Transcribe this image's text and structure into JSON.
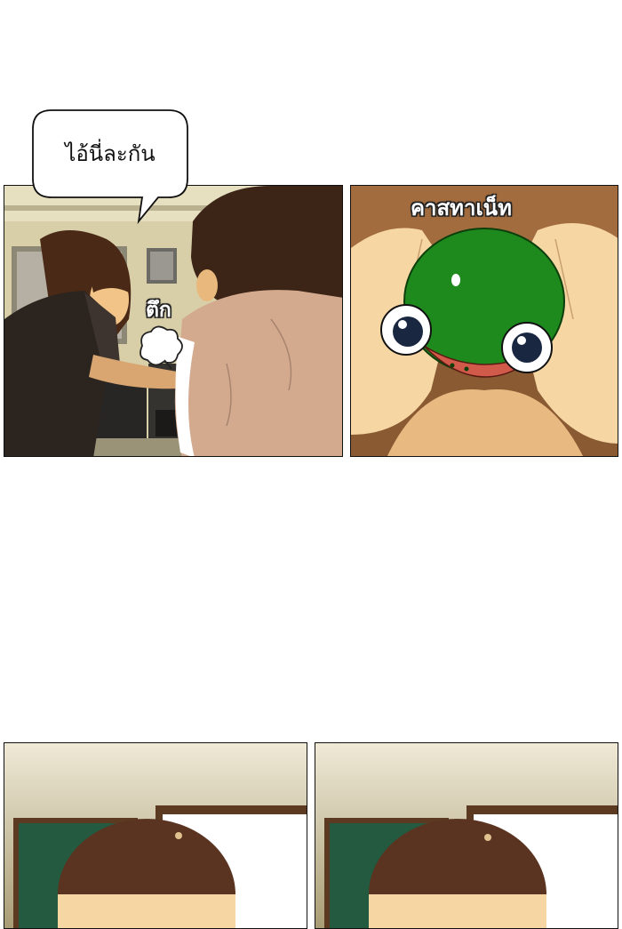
{
  "panel1": {
    "speech_bubble_text": "ไอ้นี่ละกัน",
    "sound_effect_text": "ตึก",
    "description_icon": "puff-icon"
  },
  "panel2": {
    "caption_text": "คาสทาเน็ท"
  },
  "colors": {
    "panel_border": "#111111",
    "frog_green": "#1e8a1e",
    "skin": "#f6d6a2",
    "hair_brown": "#5a3420",
    "chalkboard": "#245a40"
  }
}
